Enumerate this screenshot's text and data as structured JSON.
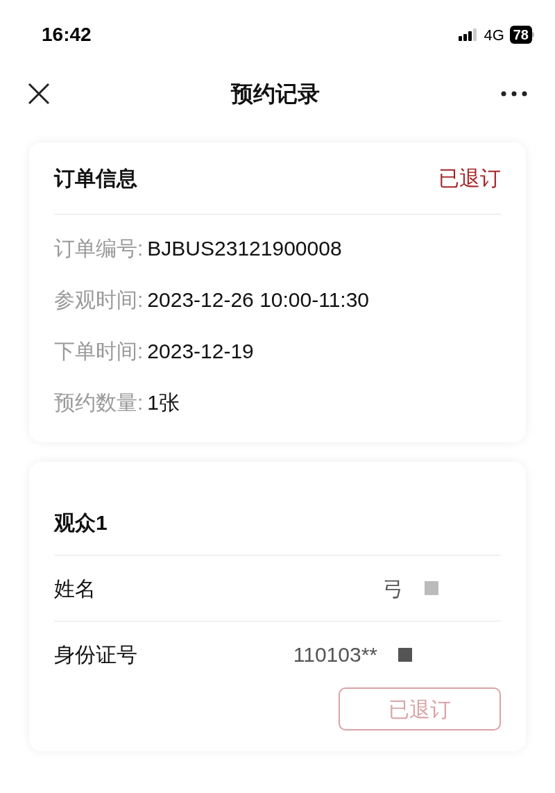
{
  "status_bar": {
    "time": "16:42",
    "network": "4G",
    "battery": "78"
  },
  "nav": {
    "title": "预约记录"
  },
  "order": {
    "title": "订单信息",
    "status": "已退订",
    "fields": [
      {
        "label": "订单编号:",
        "value": "BJBUS23121900008"
      },
      {
        "label": "参观时间:",
        "value": "2023-12-26 10:00-11:30"
      },
      {
        "label": "下单时间:",
        "value": "2023-12-19"
      },
      {
        "label": "预约数量:",
        "value": "1张"
      }
    ]
  },
  "visitor": {
    "title": "观众1",
    "fields": [
      {
        "label": "姓名",
        "value": "弓"
      },
      {
        "label": "身份证号",
        "value": "110103**"
      }
    ],
    "button": {
      "label": "已退订",
      "disabled": true
    }
  }
}
